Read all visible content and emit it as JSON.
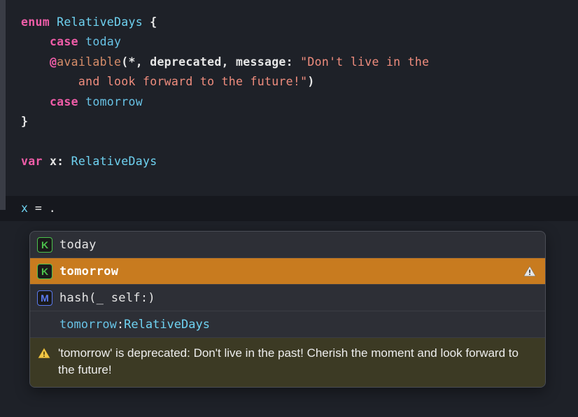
{
  "code": {
    "kw_enum": "enum",
    "type_name": "RelativeDays",
    "brace_open": " {",
    "kw_case1": "case",
    "case1": "today",
    "at": "@",
    "attr": "available",
    "attr_args1": "(*, deprecated, message: ",
    "str1": "\"Don't live in the ",
    "str2": "and look forward to the future!\"",
    "attr_close": ")",
    "kw_case2": "case",
    "case2": "tomorrow",
    "brace_close": "}",
    "kw_var": "var",
    "var_name": "x",
    "colon": ": ",
    "var_type": "RelativeDays"
  },
  "input_bar": {
    "x": "x",
    "eq": " = ."
  },
  "completions": {
    "items": [
      {
        "icon": "K",
        "label": "today"
      },
      {
        "icon": "K",
        "label": "tomorrow"
      },
      {
        "icon": "M",
        "label": "hash(_ self:)"
      }
    ],
    "detail": {
      "name": "tomorrow",
      "colon": ": ",
      "type": "RelativeDays"
    },
    "warning": "'tomorrow' is deprecated: Don't live in the past! Cherish the moment and look forward to the future!"
  }
}
